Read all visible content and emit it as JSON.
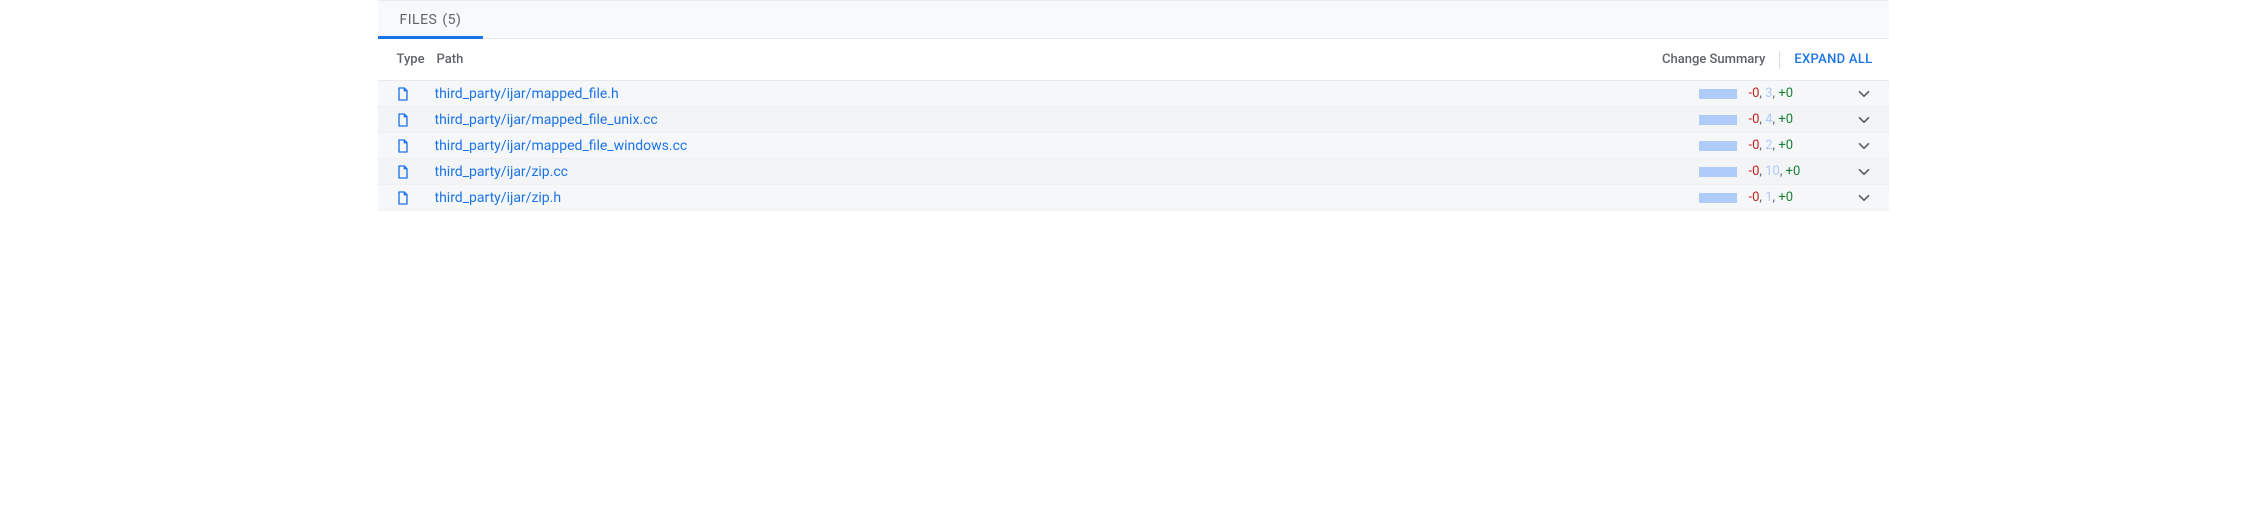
{
  "tabs": {
    "files": {
      "label": "FILES",
      "count": 5
    }
  },
  "headers": {
    "type": "Type",
    "path": "Path",
    "change_summary": "Change Summary",
    "expand_all": "EXPAND ALL"
  },
  "files": [
    {
      "path": "third_party/ijar/mapped_file.h",
      "deleted": 0,
      "modified": 3,
      "inserted": 0
    },
    {
      "path": "third_party/ijar/mapped_file_unix.cc",
      "deleted": 0,
      "modified": 4,
      "inserted": 0
    },
    {
      "path": "third_party/ijar/mapped_file_windows.cc",
      "deleted": 0,
      "modified": 2,
      "inserted": 0
    },
    {
      "path": "third_party/ijar/zip.cc",
      "deleted": 0,
      "modified": 10,
      "inserted": 0
    },
    {
      "path": "third_party/ijar/zip.h",
      "deleted": 0,
      "modified": 1,
      "inserted": 0
    }
  ],
  "colors": {
    "link": "#1a73e8",
    "bar": "#aecbfa",
    "del": "#c5221f",
    "mod": "#aecbfa",
    "ins": "#188038"
  }
}
